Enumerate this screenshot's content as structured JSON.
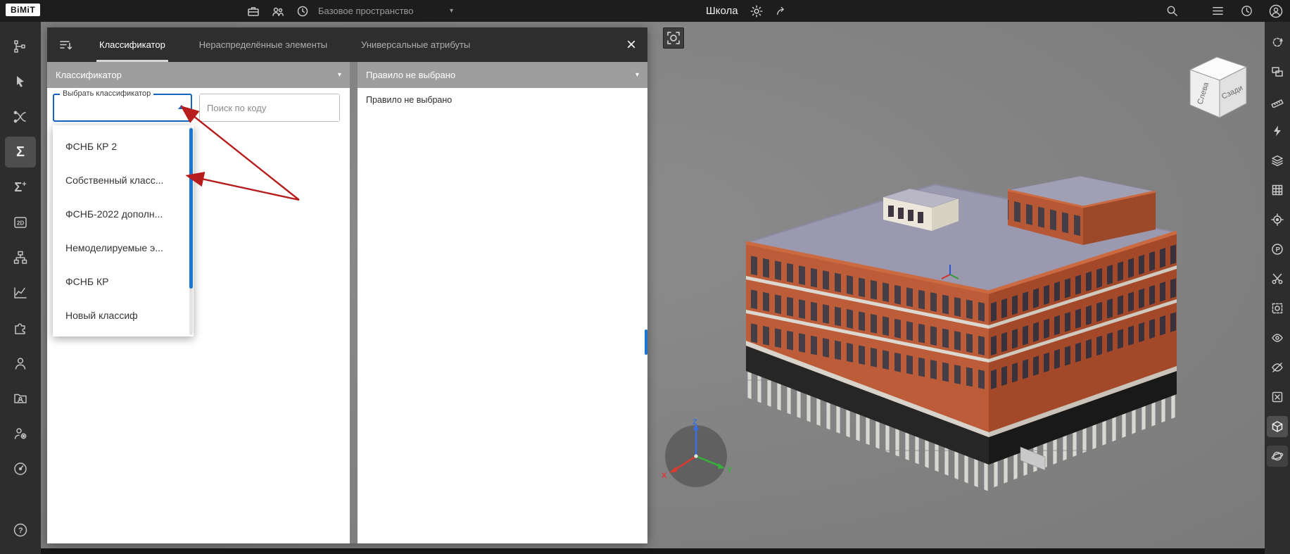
{
  "top_bar": {
    "logo": "BiMiT",
    "workspace": "Базовое пространство",
    "title": "Школа"
  },
  "panel": {
    "tabs": {
      "classifier": "Классификатор",
      "unassigned": "Нераспределённые элементы",
      "universal": "Универсальные атрибуты"
    },
    "classifier": {
      "header": "Классификатор",
      "select_label": "Выбрать классификатор",
      "search_placeholder": "Поиск по коду",
      "options": [
        "ФСНБ КР 2",
        "Собственный класс...",
        "ФСНБ-2022 дополн...",
        "Немоделируемые э...",
        "ФСНБ КР",
        "Новый классиф"
      ]
    },
    "rule": {
      "header": "Правило не выбрано",
      "empty": "Правило не выбрано"
    }
  },
  "viewport": {
    "cube": {
      "left": "Слева",
      "right": "Сзади"
    },
    "axes": {
      "x": "X",
      "y": "Y",
      "z": "Z"
    }
  },
  "colors": {
    "accent_blue": "#1b76d2",
    "annotation_red": "#b81d1d",
    "panel_header_gray": "#9e9e9e"
  }
}
